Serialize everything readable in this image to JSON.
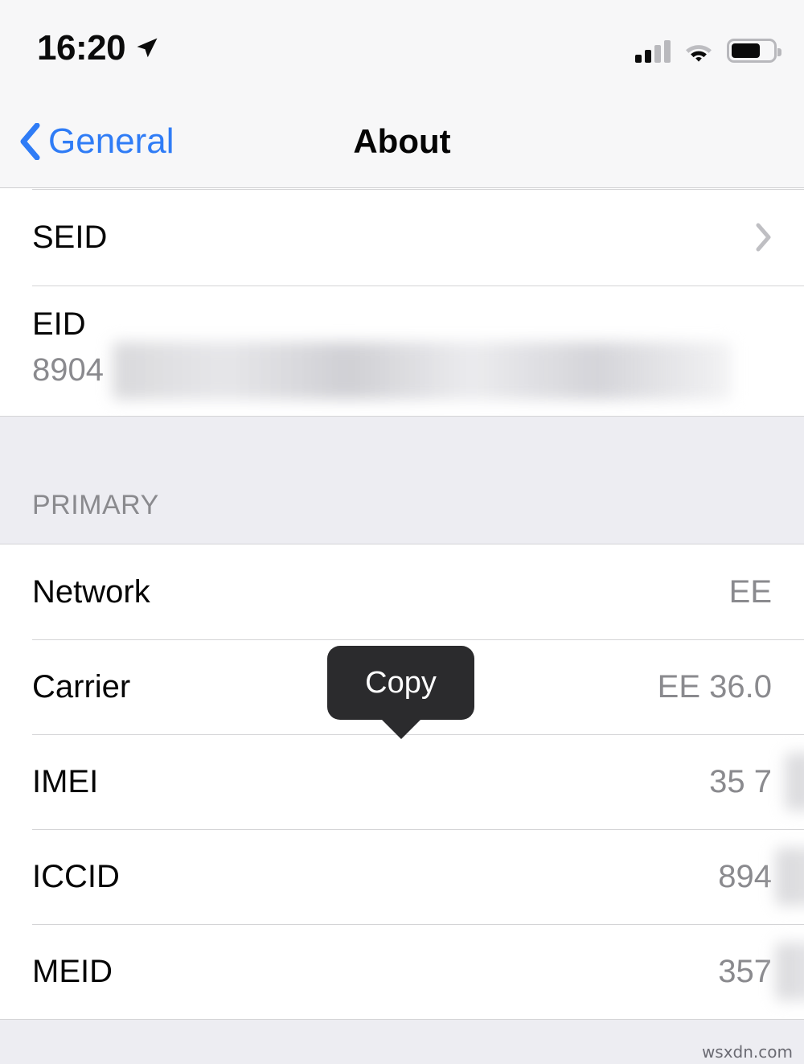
{
  "status_bar": {
    "time": "16:20",
    "location_icon": "location-arrow-icon",
    "cellular_icon": "cellular-signal-icon",
    "cellular_bars_filled": 2,
    "cellular_bars_total": 4,
    "wifi_icon": "wifi-icon",
    "battery_icon": "battery-icon",
    "battery_percent": 70
  },
  "nav": {
    "back_label": "General",
    "back_icon": "chevron-left-icon",
    "title": "About"
  },
  "groups": [
    {
      "rows": [
        {
          "label": "SEID",
          "value": "",
          "accessory": "chevron-right-icon",
          "redacted": false,
          "layout": "inline"
        },
        {
          "label": "EID",
          "value": "8904",
          "accessory": "",
          "redacted": true,
          "layout": "stacked"
        }
      ]
    }
  ],
  "section": {
    "header": "PRIMARY",
    "rows": [
      {
        "label": "Network",
        "value": "EE",
        "redacted": false
      },
      {
        "label": "Carrier",
        "value": "EE 36.0",
        "redacted": false
      },
      {
        "label": "IMEI",
        "value": "35 7",
        "redacted": true
      },
      {
        "label": "ICCID",
        "value": "894",
        "redacted": true
      },
      {
        "label": "MEID",
        "value": "357",
        "redacted": true
      }
    ]
  },
  "tooltip": {
    "label": "Copy"
  },
  "footer": {
    "watermark": "wsxdn.com"
  },
  "colors": {
    "accent_blue": "#2f7cf6",
    "value_gray": "#8a8a8e",
    "section_bg": "#ededf2",
    "tooltip_bg": "#2b2b2d",
    "separator": "#d4d4d6"
  }
}
